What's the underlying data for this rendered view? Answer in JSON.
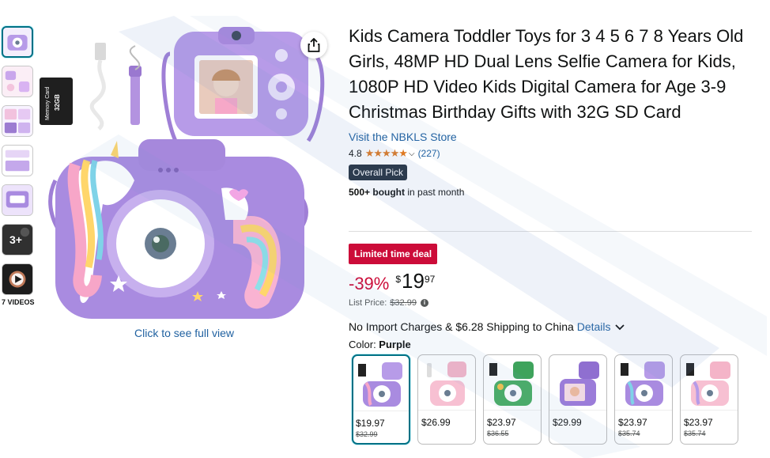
{
  "gallery": {
    "thumbnails": [
      "camera-front",
      "accessories",
      "features",
      "details",
      "sizes",
      "age-3plus",
      "video"
    ],
    "video_count_label": "7 VIDEOS",
    "full_view_label": "Click to see full view",
    "age_badge": "3+",
    "memory_card": {
      "line1": "Memory Card",
      "line2": "32GB"
    }
  },
  "product": {
    "title": "Kids Camera Toddler Toys for 3 4 5 6 7 8 Years Old Girls, 48MP HD Dual Lens Selfie Camera for Kids, 1080P HD Video Kids Digital Camera for Age 3-9 Christmas Birthday Gifts with 32G SD Card",
    "store_link": "Visit the NBKLS Store",
    "rating": "4.8",
    "stars": "★★★★★",
    "review_count": "(227)",
    "badge": "Overall Pick",
    "bought_bold": "500+ bought",
    "bought_rest": " in past month"
  },
  "pricing": {
    "deal_label": "Limited time deal",
    "discount": "-39%",
    "currency": "$",
    "whole": "19",
    "fraction": "97",
    "list_price_label": "List Price:",
    "list_price": "$32.99",
    "shipping_text": "No Import Charges & $6.28 Shipping to China ",
    "details_link": "Details"
  },
  "color": {
    "label": "Color: ",
    "selected": "Purple",
    "options": [
      {
        "price": "$19.97",
        "old": "$32.99",
        "theme": "purple-unicorn"
      },
      {
        "price": "$26.99",
        "old": "",
        "theme": "pink"
      },
      {
        "price": "$23.97",
        "old": "$36.55",
        "theme": "green-dino"
      },
      {
        "price": "$29.99",
        "old": "",
        "theme": "purple-plain"
      },
      {
        "price": "$23.97",
        "old": "$35.74",
        "theme": "purple-unicorn"
      },
      {
        "price": "$23.97",
        "old": "$35.74",
        "theme": "pink-unicorn"
      }
    ]
  },
  "colors": {
    "link": "#2162a1",
    "deal_red": "#cc0c39",
    "star": "#de7921",
    "badge_bg": "#232f3e",
    "selected_border": "#007185",
    "camera_purple": "#a98be0"
  }
}
